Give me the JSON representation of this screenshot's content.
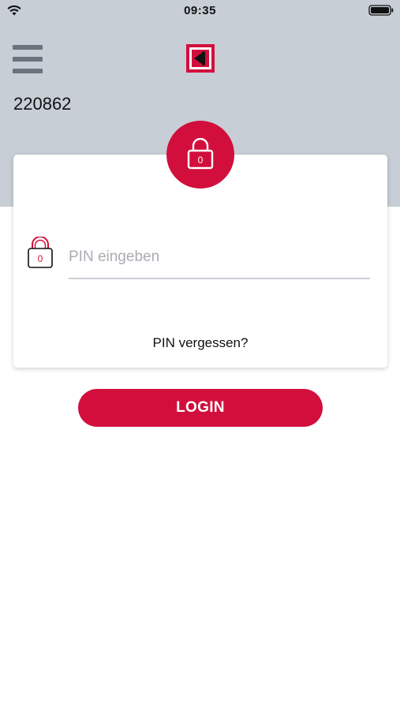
{
  "status_bar": {
    "time": "09:35",
    "wifi_icon": "wifi-icon",
    "battery_icon": "battery-icon"
  },
  "header": {
    "menu_icon": "hamburger-menu-icon",
    "logo_icon": "bank-logo-icon",
    "account_number": "220862"
  },
  "login_card": {
    "badge_icon": "lock-icon",
    "badge_lock_digit": "0",
    "field_icon": "lock-outline-icon",
    "field_lock_digit": "0",
    "pin_placeholder": "PIN eingeben",
    "pin_value": "",
    "forgot_label": "PIN vergessen?"
  },
  "actions": {
    "login_label": "LOGIN"
  },
  "colors": {
    "brand_red": "#d20f3c",
    "header_gray": "#c7ced6",
    "menu_gray": "#6b737c",
    "divider_gray": "#c9ced3"
  }
}
